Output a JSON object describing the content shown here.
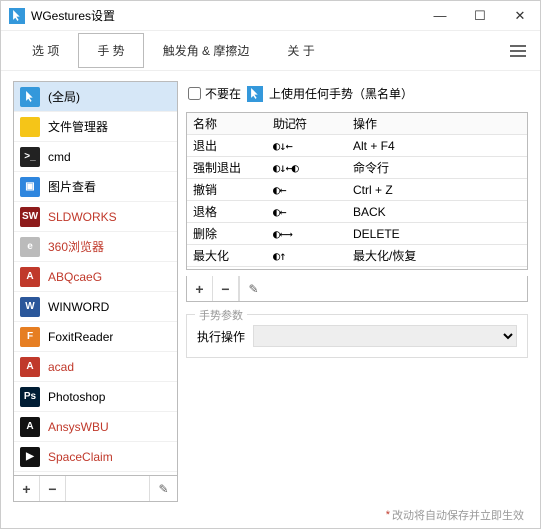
{
  "window": {
    "title": "WGestures设置"
  },
  "tabs": [
    "选 项",
    "手 势",
    "触发角 & 摩擦边",
    "关 于"
  ],
  "blacklist": {
    "prefix": "不要在",
    "suffix": "上使用任何手势（黑名单）"
  },
  "applist": [
    {
      "label": "(全局)",
      "color": "#3498db",
      "txt": "",
      "red": false,
      "selected": true,
      "cursor": true
    },
    {
      "label": "文件管理器",
      "color": "#f5c518",
      "txt": "",
      "red": false
    },
    {
      "label": "cmd",
      "color": "#222",
      "txt": ">_",
      "red": false
    },
    {
      "label": "图片查看",
      "color": "#2e86de",
      "txt": "▣",
      "red": false
    },
    {
      "label": "SLDWORKS",
      "color": "#8e1b1b",
      "txt": "SW",
      "red": true
    },
    {
      "label": "360浏览器",
      "color": "#bbb",
      "txt": "e",
      "red": true
    },
    {
      "label": "ABQcaeG",
      "color": "#c0392b",
      "txt": "A",
      "red": true
    },
    {
      "label": "WINWORD",
      "color": "#2b579a",
      "txt": "W",
      "red": false
    },
    {
      "label": "FoxitReader",
      "color": "#e67e22",
      "txt": "F",
      "red": false
    },
    {
      "label": "acad",
      "color": "#c0392b",
      "txt": "A",
      "red": true
    },
    {
      "label": "Photoshop",
      "color": "#001d34",
      "txt": "Ps",
      "red": false
    },
    {
      "label": "AnsysWBU",
      "color": "#111",
      "txt": "A",
      "red": true
    },
    {
      "label": "SpaceClaim",
      "color": "#111",
      "txt": "▶",
      "red": true
    }
  ],
  "gesture_headers": {
    "c1": "名称",
    "c2": "助记符",
    "c3": "操作"
  },
  "gestures": [
    {
      "name": "退出",
      "mnemonic": "◐↓←",
      "action": "Alt + F4"
    },
    {
      "name": "强制退出",
      "mnemonic": "◐↓←◐",
      "action": "命令行"
    },
    {
      "name": "撤销",
      "mnemonic": "◐←",
      "action": "Ctrl + Z"
    },
    {
      "name": "退格",
      "mnemonic": "◐←",
      "action": "BACK"
    },
    {
      "name": "删除",
      "mnemonic": "◐←→",
      "action": "DELETE"
    },
    {
      "name": "最大化",
      "mnemonic": "◐↑",
      "action": "最大化/恢复"
    }
  ],
  "params": {
    "group": "手势参数",
    "label": "执行操作"
  },
  "footer": "改动将自动保存并立即生效"
}
